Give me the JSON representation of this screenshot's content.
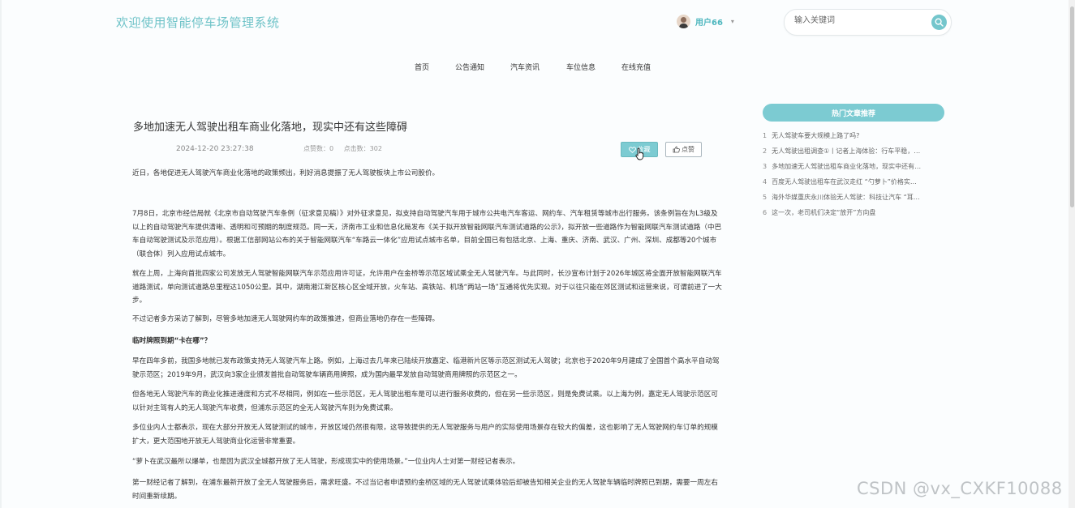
{
  "header": {
    "site_title": "欢迎使用智能停车场管理系统",
    "username": "用户66",
    "caret": "▾",
    "search_placeholder": "输入关键词"
  },
  "nav": {
    "items": [
      "首页",
      "公告通知",
      "汽车资讯",
      "车位信息",
      "在线充值"
    ]
  },
  "article": {
    "title": "多地加速无人驾驶出租车商业化落地，现实中还有这些障碍",
    "date": "2024-12-20 23:27:38",
    "like_count_text": "点赞数：0",
    "click_count_text": "点击数：302",
    "fav_label": "收藏",
    "like_label": "点赞",
    "paragraphs": [
      "近日，各地促进无人驾驶汽车商业化落地的政策频出，利好消息提振了无人驾驶板块上市公司股价。",
      "7月8日，北京市经信局就《北京市自动驾驶汽车条例（征求意见稿）》对外征求意见，拟支持自动驾驶汽车用于城市公共电汽车客运、网约车、汽车租赁等城市出行服务。该条例旨在为L3级及以上的自动驾驶汽车提供清晰、透明和可预期的制度规范。同一天，济南市工业和信息化局发布《关于拟开放智能网联汽车测试道路的公示》，拟开放一些道路作为智能网联汽车测试道路（中巴车自动驾驶测试及示范应用）。根据工信部网站公布的关于智能网联汽车“车路云一体化”应用试点城市名单，目前全国已有包括北京、上海、重庆、济南、武汉、广州、深圳、成都等20个城市（联合体）列入应用试点城市。",
      "就在上周，上海向首批四家公司发放无人驾驶智能网联汽车示范应用许可证，允许用户在金桥等示范区域试乘全无人驾驶汽车。与此同时，长沙宣布计划于2026年城区将全面开放智能网联汽车道路测试，单向测试道路总里程达1050公里。其中，湖南湘江新区核心区全域开放，火车站、高铁站、机场“两站一场”互通将优先实现。对于以往只能在郊区测试和运营来说，可谓前进了一大步。",
      "不过记者多方采访了解到，尽管多地加速无人驾驶网约车的政策推进，但商业落地仍存在一些障碍。",
      "临时牌照到期“卡在哪”？",
      "早在四年多前，我国多地就已发布政策支持无人驾驶汽车上路。例如，上海过去几年来已陆续开放嘉定、临港新片区等示范区测试无人驾驶；北京也于2020年9月建成了全国首个高水平自动驾驶示范区；2019年9月，武汉向3家企业颁发首批自动驾驶车辆商用牌照，成为国内最早发放自动驾驶商用牌照的示范区之一。",
      "但各地无人驾驶汽车的商业化推进速度和方式不尽相同，例如在一些示范区，无人驾驶出租车是可以进行服务收费的，但在另一些示范区，则是免费试乘。以上海为例，嘉定无人驾驶示范区可以针对主驾有人的无人驾驶汽车收费，但浦东示范区的全无人驾驶汽车则为免费试乘。",
      "多位业内人士都表示，现在大部分开放无人驾驶测试的城市，开放区域仍然很有限，这导致提供的无人驾驶服务与用户的实际使用场景存在较大的偏差，这也影响了无人驾驶网约车订单的规模扩大，更大范围地开放无人驾驶商业化运营非常重要。",
      "“萝卜在武汉最所以爆单，也是因为武汉全城都开放了无人驾驶，形成现实中的使用场景。”一位业内人士对第一财经记者表示。",
      "第一财经记者了解到，在浦东最新开放了全无人驾驶服务后，需求旺盛。不过当记者申请预约金桥区域的无人驾驶试乘体验后却被告知相关企业的无人驾驶车辆临时牌照已到期，需要一周左右时间重新续期。"
    ]
  },
  "sidebar": {
    "heading": "热门文章推荐",
    "items": [
      {
        "num": "1",
        "text": "无人驾驶车要大规模上路了吗?"
      },
      {
        "num": "2",
        "text": "无人驾驶出租调查①丨记者上海体验：行车平稳，…"
      },
      {
        "num": "3",
        "text": "多地加速无人驾驶出租车商业化落地，现实中还有…"
      },
      {
        "num": "4",
        "text": "百度无人驾驶出租车在武汉走红 “勺萝卜”价格实…"
      },
      {
        "num": "5",
        "text": "海外华媒重庆永川体验无人驾驶：科技让汽车 “耳…"
      },
      {
        "num": "6",
        "text": "这一次，老司机们决定“放开”方向盘"
      }
    ]
  },
  "watermark": "CSDN @vx_CXKF10088",
  "colors": {
    "accent": "#74c6cc",
    "title_color": "#6fc3c8"
  }
}
